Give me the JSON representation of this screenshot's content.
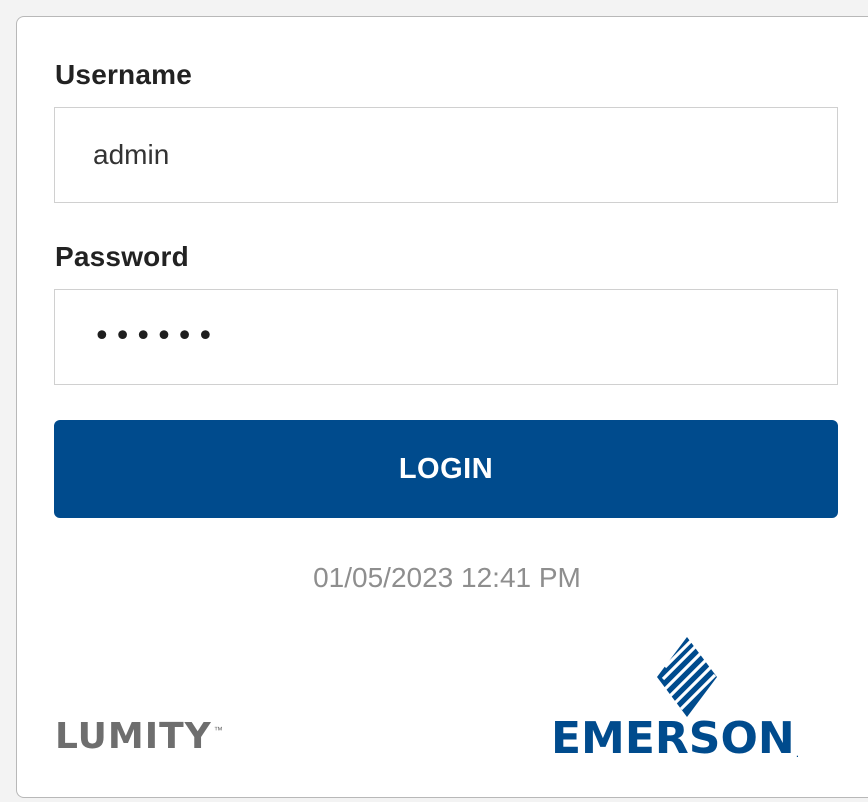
{
  "login": {
    "username_label": "Username",
    "username_value": "admin",
    "password_label": "Password",
    "password_display": "••••••",
    "button_label": "LOGIN",
    "datetime": "01/05/2023 12:41 PM"
  },
  "logos": {
    "lumity": "LUMITY",
    "lumity_tm": "™",
    "emerson": "EMERSON",
    "emerson_dot": "."
  },
  "colors": {
    "primary_button": "#004b8d",
    "emerson_blue": "#004b8d",
    "lumity_gray": "#6e6e6e",
    "datetime_gray": "#8e8e8e"
  }
}
